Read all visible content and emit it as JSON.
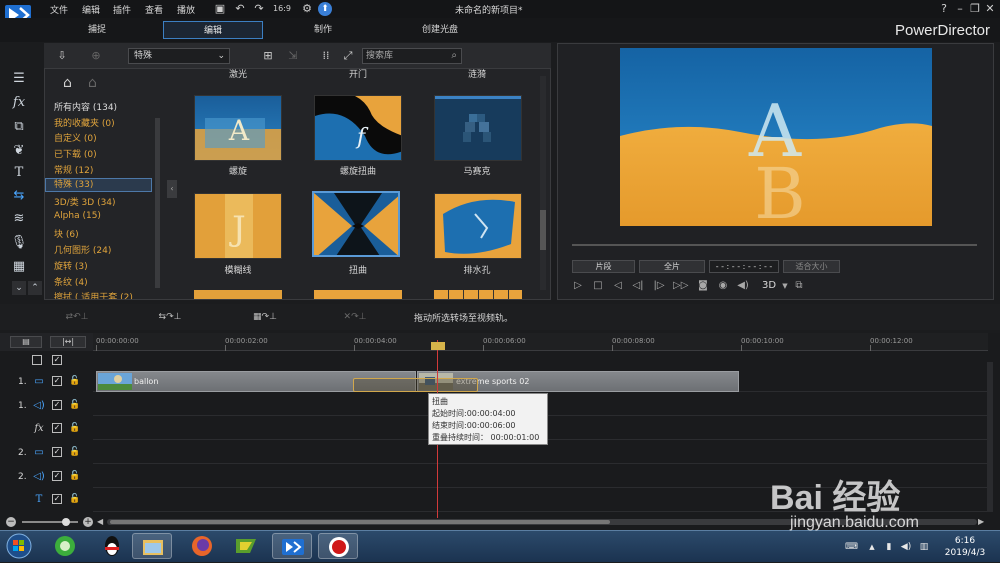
{
  "menu": [
    "文件",
    "编辑",
    "插件",
    "查看",
    "播放"
  ],
  "window_title": "未命名的新项目*",
  "window_controls": [
    "?",
    "–",
    "❐",
    "✕"
  ],
  "mode_tabs": [
    {
      "label": "捕捉",
      "active": false
    },
    {
      "label": "编辑",
      "active": true
    },
    {
      "label": "制作",
      "active": false
    },
    {
      "label": "创建光盘",
      "active": false
    }
  ],
  "brand": "PowerDirector",
  "library": {
    "category_select": "特殊",
    "search_placeholder": "搜索库",
    "categories": [
      {
        "label": "所有内容 (134)",
        "style": "white"
      },
      {
        "label": "我的收藏夹 (0)",
        "style": "orange"
      },
      {
        "label": "自定义 (0)",
        "style": "orange"
      },
      {
        "label": "已下载 (0)",
        "style": "orange"
      },
      {
        "label": "常规 (12)",
        "style": "orange"
      },
      {
        "label": "特殊 (33)",
        "style": "selected"
      },
      {
        "label": "3D/类 3D (34)",
        "style": "orange"
      },
      {
        "label": "Alpha (15)",
        "style": "orange"
      },
      {
        "label": "块 (6)",
        "style": "orange"
      },
      {
        "label": "几何图形 (24)",
        "style": "orange"
      },
      {
        "label": "旋转 (3)",
        "style": "orange"
      },
      {
        "label": "条纹 (4)",
        "style": "orange"
      },
      {
        "label": "擦拭 ( 适用于套 (2)",
        "style": "orange"
      }
    ],
    "top_labels": [
      "激光",
      "开门",
      "涟漪"
    ],
    "items": [
      {
        "label": "螺旋"
      },
      {
        "label": "螺旋扭曲"
      },
      {
        "label": "马赛克"
      },
      {
        "label": "模糊线"
      },
      {
        "label": "扭曲",
        "selected": true
      },
      {
        "label": "排水孔"
      }
    ]
  },
  "preview": {
    "btn_clip": "片段",
    "btn_full": "全片",
    "timecode": "- - : - - : - - : - -",
    "size_label": "适合大小",
    "mode_3d": "3D"
  },
  "midbar": {
    "hint": "拖动所选转场至视频轨。"
  },
  "timeline": {
    "ticks": [
      "00:00:00:00",
      "00:00:02:00",
      "00:00:04:00",
      "00:00:06:00",
      "00:00:08:00",
      "00:00:10:00",
      "00:00:12:00"
    ],
    "tracks": [
      {
        "label": "1.",
        "icon": "video"
      },
      {
        "label": "1.",
        "icon": "audio"
      },
      {
        "label": "",
        "icon": "fx"
      },
      {
        "label": "2.",
        "icon": "video"
      },
      {
        "label": "2.",
        "icon": "audio"
      },
      {
        "label": "",
        "icon": "title"
      }
    ],
    "clip1": "ballon",
    "clip2": "extreme sports 02",
    "tooltip": {
      "title": "扭曲",
      "start": "起始时间:00:00:04:00",
      "end": "结束时间:00:00:06:00",
      "overlap": "重叠持续时间： 00:00:01:00"
    }
  },
  "taskbar": {
    "time": "6:16",
    "date": "2019/4/3"
  },
  "watermark": {
    "text": "Bai 经验",
    "url": "jingyan.baidu.com"
  },
  "colors": {
    "accent": "#3c7fc2",
    "category_orange": "#e0a43c",
    "playhead": "#d23a3a"
  }
}
